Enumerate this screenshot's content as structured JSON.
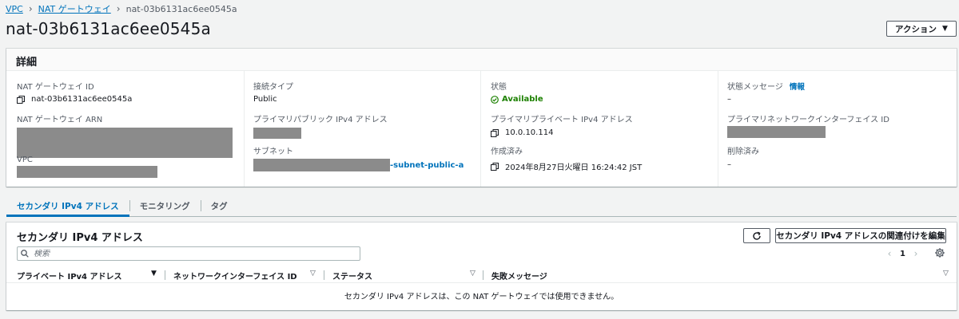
{
  "breadcrumb": {
    "items": [
      "VPC",
      "NAT ゲートウェイ"
    ],
    "current": "nat-03b6131ac6ee0545a"
  },
  "page_title": "nat-03b6131ac6ee0545a",
  "actions_button": "アクション",
  "details": {
    "header": "詳細",
    "nat_id": {
      "label": "NAT ゲートウェイ ID",
      "value": "nat-03b6131ac6ee0545a"
    },
    "nat_arn": {
      "label": "NAT ゲートウェイ ARN"
    },
    "vpc": {
      "label": "VPC"
    },
    "conn_type": {
      "label": "接続タイプ",
      "value": "Public"
    },
    "primary_public_ip": {
      "label": "プライマリパブリック IPv4 アドレス"
    },
    "subnet": {
      "label": "サブネット",
      "value_suffix": "-subnet-public-a"
    },
    "state": {
      "label": "状態",
      "value": "Available"
    },
    "primary_private_ip": {
      "label": "プライマリプライベート IPv4 アドレス",
      "value": "10.0.10.114"
    },
    "created": {
      "label": "作成済み",
      "value": "2024年8月27日火曜日 16:24:42 JST"
    },
    "state_message": {
      "label": "状態メッセージ",
      "info": "情報",
      "value": "–"
    },
    "primary_eni": {
      "label": "プライマリネットワークインターフェイス ID"
    },
    "deleted": {
      "label": "削除済み",
      "value": "–"
    }
  },
  "tabs": [
    "セカンダリ IPv4 アドレス",
    "モニタリング",
    "タグ"
  ],
  "secondary": {
    "title": "セカンダリ IPv4 アドレス",
    "associate_button": "セカンダリ IPv4 アドレスの関連付けを編集",
    "search_placeholder": "検索",
    "page": "1",
    "columns": [
      "プライベート IPv4 アドレス",
      "ネットワークインターフェイス ID",
      "ステータス",
      "失敗メッセージ"
    ],
    "empty_message": "セカンダリ IPv4 アドレスは、この NAT ゲートウェイでは使用できません。"
  },
  "colors": {
    "link": "#0073bb",
    "success": "#1d8102",
    "background": "#f2f3f3",
    "redaction": "#8b8b8b"
  }
}
